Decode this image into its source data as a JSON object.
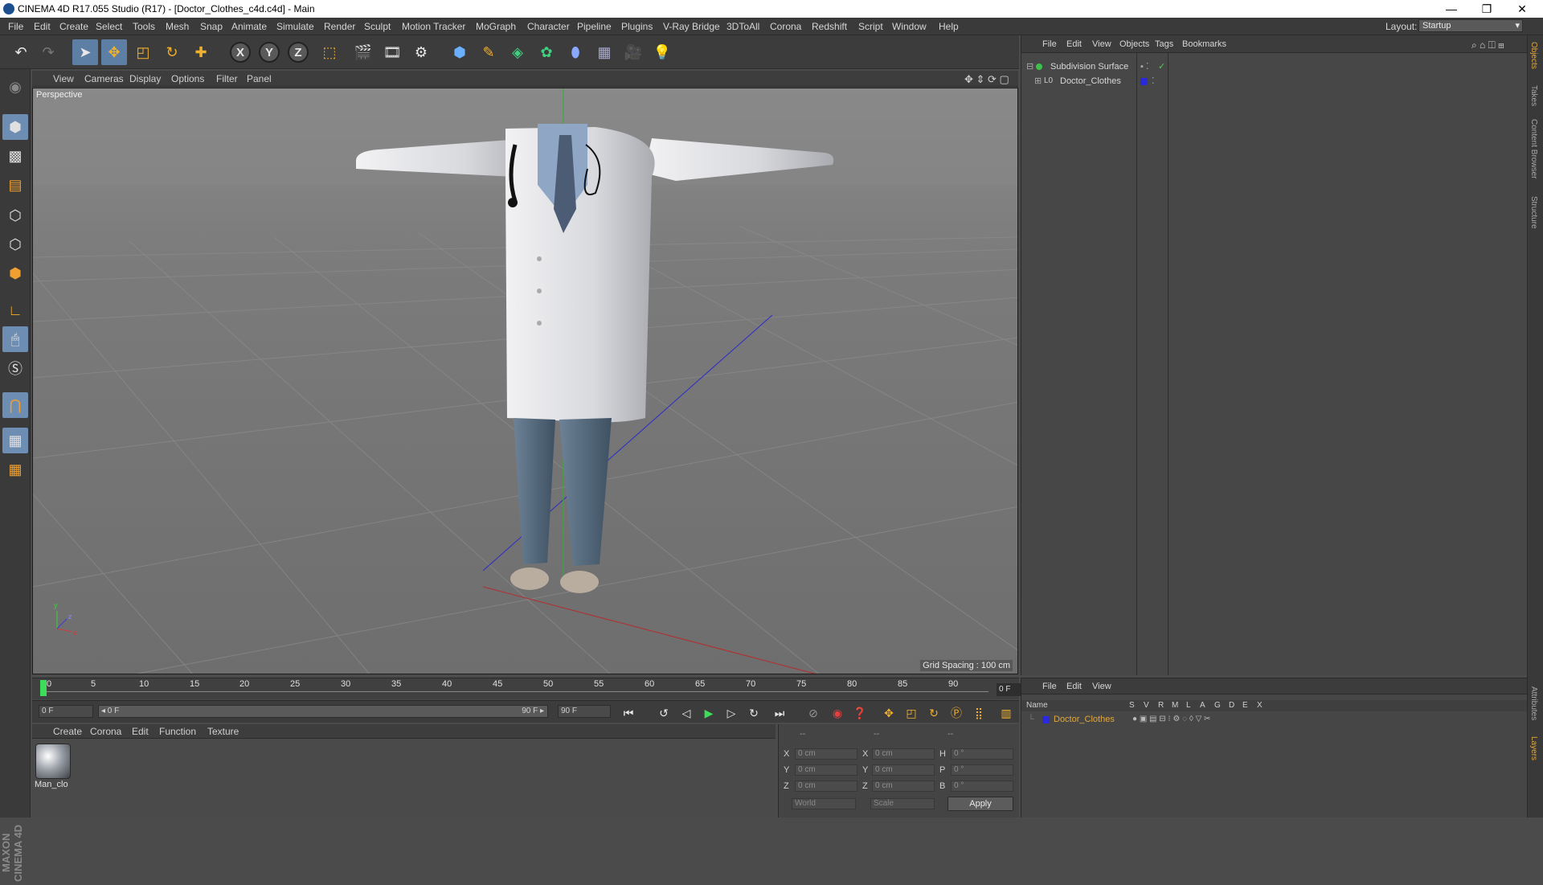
{
  "window": {
    "title": "CINEMA 4D R17.055 Studio (R17) - [Doctor_Clothes_c4d.c4d] - Main",
    "minimize": "—",
    "maximize": "❐",
    "close": "✕"
  },
  "menubar": {
    "items": [
      "File",
      "Edit",
      "Create",
      "Select",
      "Tools",
      "Mesh",
      "Snap",
      "Animate",
      "Simulate",
      "Render",
      "Sculpt",
      "Motion Tracker",
      "MoGraph",
      "Character",
      "Pipeline",
      "Plugins",
      "V-Ray Bridge",
      "3DToAll",
      "Corona",
      "Redshift",
      "Script",
      "Window",
      "Help"
    ],
    "layout_label": "Layout:",
    "layout_value": "Startup"
  },
  "toolbar": {
    "icons": [
      "undo-icon",
      "redo-icon",
      "select-arrow-icon",
      "move-icon",
      "scale-icon",
      "rotate-icon",
      "transform-icon",
      "x-axis-lock",
      "y-axis-lock",
      "z-axis-lock",
      "coordinate-system-icon",
      "render-view-icon",
      "render-picture-viewer-icon",
      "render-settings-icon",
      "cube-primitive-icon",
      "pen-spline-icon",
      "subdivision-nurbs-icon",
      "cloner-icon",
      "deformer-icon",
      "floor-icon",
      "camera-icon",
      "light-icon"
    ],
    "x_label": "X",
    "y_label": "Y",
    "z_label": "Z"
  },
  "viewport": {
    "menu": [
      "View",
      "Cameras",
      "Display",
      "Options",
      "Filter",
      "Panel"
    ],
    "label": "Perspective",
    "grid_spacing": "Grid Spacing : 100 cm",
    "axis_y": "y",
    "axis_z": "z",
    "axis_x": "x"
  },
  "timeline": {
    "ticks": [
      "0",
      "5",
      "10",
      "15",
      "20",
      "25",
      "30",
      "35",
      "40",
      "45",
      "50",
      "55",
      "60",
      "65",
      "70",
      "75",
      "80",
      "85",
      "90"
    ],
    "frame_display": "0 F"
  },
  "transport": {
    "start_field": "0 F",
    "range_start": "◂ 0 F",
    "range_end": "90 F ▸",
    "end_field": "90 F"
  },
  "materials": {
    "menu": [
      "Create",
      "Corona",
      "Edit",
      "Function",
      "Texture"
    ],
    "items": [
      {
        "name": "Man_clo"
      }
    ]
  },
  "coordinates": {
    "headers": [
      "--",
      "--",
      "--"
    ],
    "rows": [
      {
        "a": "X",
        "av": "0 cm",
        "b": "X",
        "bv": "0 cm",
        "c": "H",
        "cv": "0 °"
      },
      {
        "a": "Y",
        "av": "0 cm",
        "b": "Y",
        "bv": "0 cm",
        "c": "P",
        "cv": "0 °"
      },
      {
        "a": "Z",
        "av": "0 cm",
        "b": "Z",
        "bv": "0 cm",
        "c": "B",
        "cv": "0 °"
      }
    ],
    "mode": "World",
    "scale_mode": "Scale",
    "apply": "Apply"
  },
  "object_manager": {
    "menu": [
      "File",
      "Edit",
      "View",
      "Objects",
      "Tags",
      "Bookmarks"
    ],
    "objects": [
      {
        "name": "Subdivision Surface",
        "color": "#3cc24a"
      },
      {
        "name": "Doctor_Clothes",
        "color": "#2a2adc"
      }
    ]
  },
  "layer_manager": {
    "menu": [
      "File",
      "Edit",
      "View"
    ],
    "header_name": "Name",
    "header_flags": [
      "S",
      "V",
      "R",
      "M",
      "L",
      "A",
      "G",
      "D",
      "E",
      "X"
    ],
    "layers": [
      {
        "name": "Doctor_Clothes",
        "color": "#2a2adc"
      }
    ]
  },
  "right_tabs": [
    "Objects",
    "Takes",
    "Content Browser",
    "Structure",
    "Attributes",
    "Layers"
  ],
  "colors": {
    "accent": "#e0a840",
    "selection": "#5d7fa6",
    "playhead": "#3ddc5a"
  }
}
